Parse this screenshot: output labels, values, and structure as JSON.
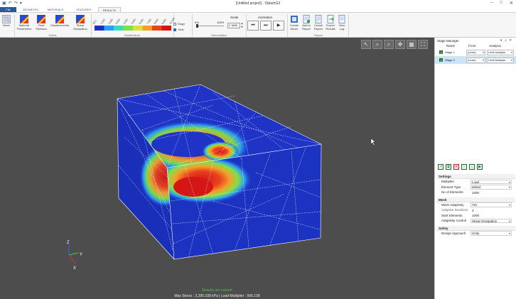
{
  "window": {
    "title": "[Untitled project] - OptumG3"
  },
  "quick_access": {
    "icons": [
      "app-icon",
      "undo-icon",
      "redo-icon",
      "customize-icon"
    ]
  },
  "tabs": [
    {
      "label": "File"
    },
    {
      "label": "GEOMETRY"
    },
    {
      "label": "MATERIALS"
    },
    {
      "label": "FEATURES"
    },
    {
      "label": "RESULTS"
    }
  ],
  "ribbon": {
    "mesh_label": "Mesh",
    "solids": {
      "group_label": "Solids",
      "material_parameters": "Material Parameters",
      "final_stresses": "Final Stresses",
      "displacements": "Displacements",
      "shear_dissipation": "Shear Dissipation"
    },
    "distributions": {
      "group_label": "Distributions",
      "ticks": [
        "58.3",
        "1,000",
        "2,000",
        "3,000",
        "4,000",
        "5,000",
        "6,000",
        "7,000",
        "8,000",
        "9,000",
        "10,000"
      ],
      "stage_label": "Stage",
      "total_label": "Total",
      "stage_checked": false,
      "total_checked": true,
      "colors": [
        "#1c2fbf",
        "#2a9df4",
        "#39d9c0",
        "#7fe04a",
        "#d8e23a",
        "#f4a12a",
        "#e8421e",
        "#d51616"
      ]
    },
    "deformation": {
      "group_label": "Deformation",
      "slider_min": "0%",
      "slider_max": "100%",
      "slider_level": 0,
      "scale_label": "Scale",
      "scale_value": "2.3895"
    },
    "animation": {
      "label": "Animation"
    },
    "report": {
      "group_label": "Report",
      "create_movie": "Create Movie",
      "add_to_report": "Add to Report",
      "create_report": "Create Report",
      "export_results": "Export Results",
      "view_log": "View Log"
    }
  },
  "stage_manager": {
    "title": "Stage Manager",
    "columns": [
      "Name",
      "From",
      "Analysis"
    ],
    "stages": [
      {
        "name": "Stage 1",
        "from": "(none)",
        "analysis": "Limit Analysis",
        "selected": false
      },
      {
        "name": "Stage 2",
        "from": "(none)",
        "analysis": "Limit Analysis",
        "selected": true
      }
    ],
    "sections": [
      {
        "title": "Settings",
        "rows": [
          {
            "key": "Multiplier",
            "value": "Load",
            "dropdown": true
          },
          {
            "key": "Element Type",
            "value": "Mixed",
            "dropdown": true
          },
          {
            "key": "No of Elements",
            "value": "1000",
            "dropdown": false
          }
        ]
      },
      {
        "title": "Mesh",
        "rows": [
          {
            "key": "Mesh Adaptivity",
            "value": "Yes",
            "dropdown": true
          },
          {
            "key": "Adaptive Iterations",
            "value": "3",
            "dropdown": false
          },
          {
            "key": "Start Elements",
            "value": "1000",
            "dropdown": false
          },
          {
            "key": "Adaptivity Control",
            "value": "Shear Dissipation",
            "dropdown": true
          }
        ]
      },
      {
        "title": "Safety",
        "rows": [
          {
            "key": "Design Approach",
            "value": "Unity",
            "dropdown": true
          }
        ]
      }
    ]
  },
  "viewport": {
    "background": "#4d4d4d",
    "status_ok": "Results are current",
    "status_values": "Max Stress : 3,395.338 kPa | Load Multiplier : 966.108",
    "axes": {
      "z": "Z",
      "y": "Y",
      "x": "X"
    }
  }
}
